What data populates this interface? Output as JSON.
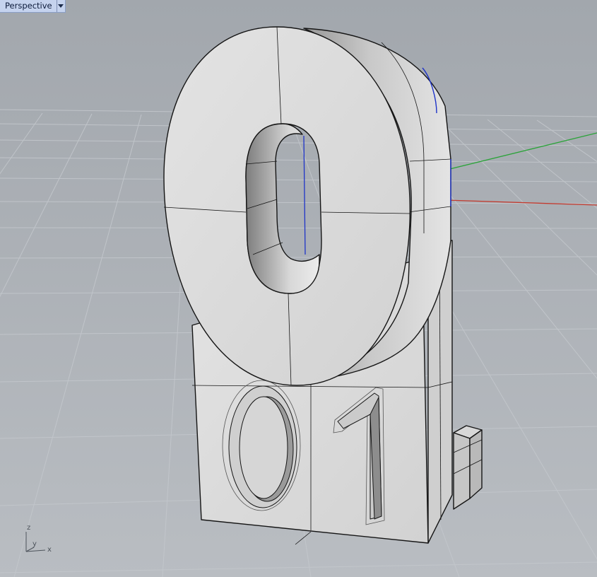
{
  "viewport": {
    "title": "Perspective",
    "menu_icon": "chevron-down-icon"
  },
  "axis_widget": {
    "z_label": "z",
    "y_label": "y",
    "x_label": "x"
  },
  "colors": {
    "background_top": "#a3a8ae",
    "background_bottom": "#b7bbc0",
    "grid_minor": "#bcc0c5",
    "grid_major": "#8f949b",
    "x_axis": "#c0392b",
    "y_axis": "#27a034",
    "model_face_light": "#dcdcdc",
    "model_face_shade": "#8a8a8a",
    "edge": "#111111",
    "tab_background": "#c5d3ee"
  },
  "model": {
    "large_digit": "0",
    "engraved_text": "01"
  }
}
